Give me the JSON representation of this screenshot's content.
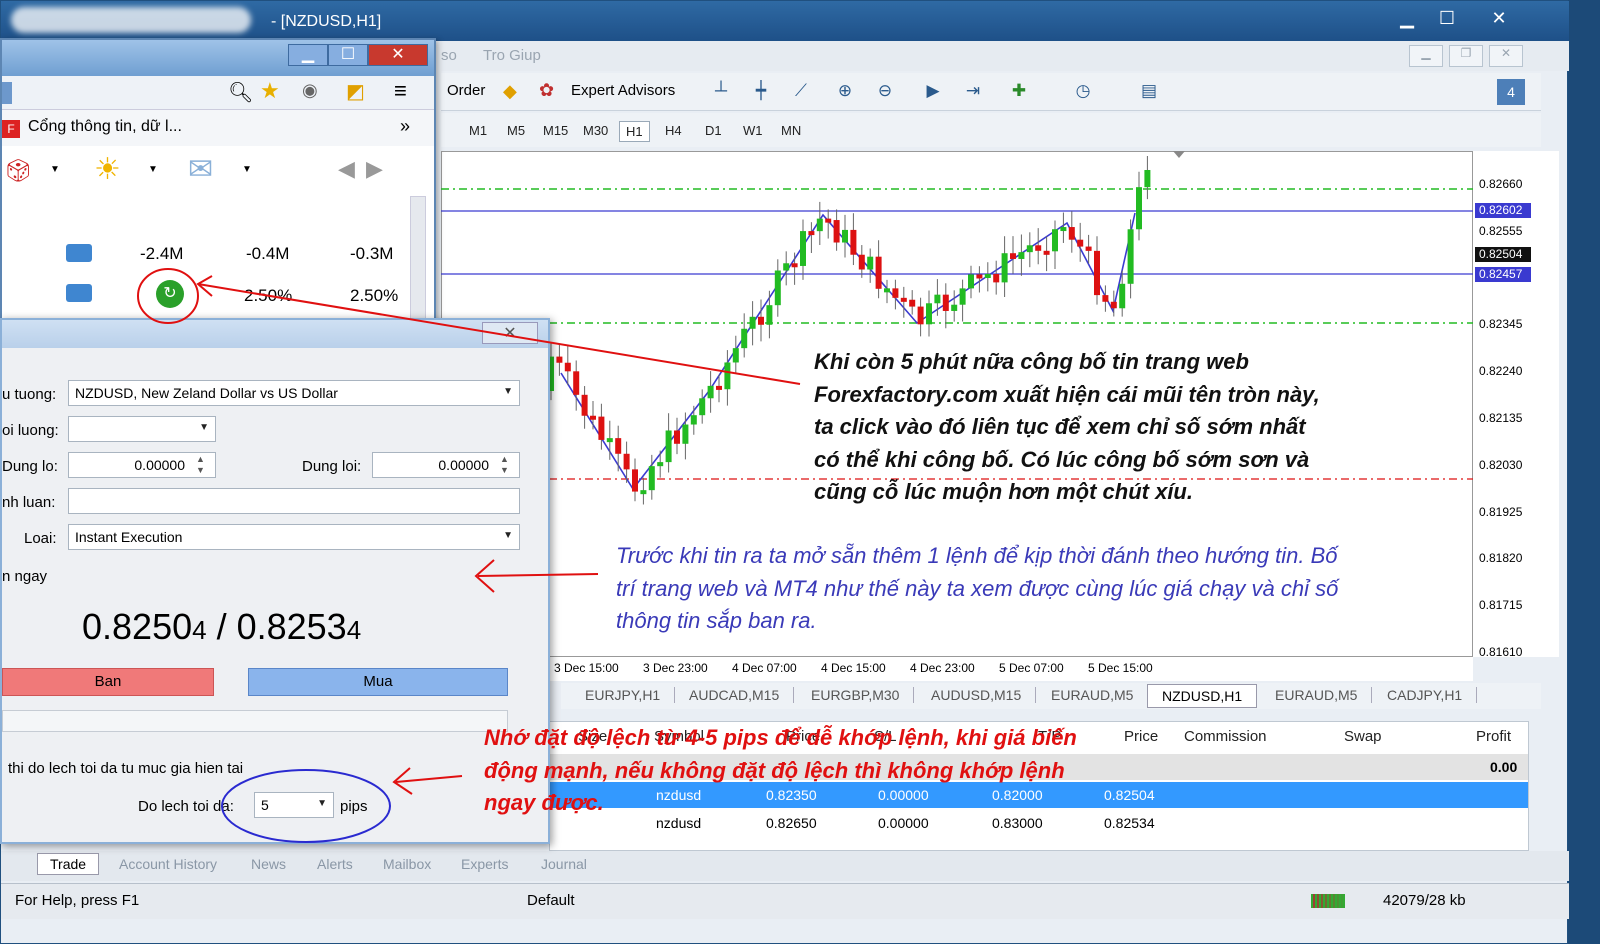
{
  "window": {
    "title": "- [NZDUSD,H1]",
    "min": "▁",
    "max": "☐",
    "close": "✕"
  },
  "menu": {
    "items": [
      "so",
      "Tro Giup"
    ]
  },
  "toolbar": {
    "order_label": "Order",
    "experts_label": "Expert Advisors"
  },
  "timeframes": [
    "M1",
    "M5",
    "M15",
    "M30",
    "H1",
    "H4",
    "D1",
    "W1",
    "MN"
  ],
  "active_timeframe": "H1",
  "chart": {
    "price_ticks": [
      "0.82660",
      "0.82555",
      "0.82450",
      "0.82345",
      "0.82240",
      "0.82135",
      "0.82030",
      "0.81925",
      "0.81820",
      "0.81715",
      "0.81610"
    ],
    "price_labels": [
      {
        "text": "0.82602",
        "color": "#3a3ad0"
      },
      {
        "text": "0.82504",
        "color": "#111111"
      },
      {
        "text": "0.82457",
        "color": "#3a3ad0"
      }
    ],
    "time_ticks": [
      "3 Dec 15:00",
      "3 Dec 23:00",
      "4 Dec 07:00",
      "4 Dec 15:00",
      "4 Dec 23:00",
      "5 Dec 07:00",
      "5 Dec 15:00"
    ],
    "bull_color": "#22bb22",
    "bear_color": "#dd1111"
  },
  "chart_tabs": [
    "EURJPY,H1",
    "AUDCAD,M15",
    "EURGBP,M30",
    "AUDUSD,M15",
    "EURAUD,M5",
    "NZDUSD,H1",
    "EURAUD,M5",
    "CADJPY,H1"
  ],
  "active_chart_tab": "NZDUSD,H1",
  "terminal": {
    "headers": [
      "Size",
      "Symbol",
      "Price",
      "S/L",
      "T/P",
      "Price",
      "Commission",
      "Swap",
      "Profit"
    ],
    "balance_profit": "0.00",
    "rows": [
      {
        "symbol": "nzdusd",
        "price": "0.82350",
        "sl": "0.00000",
        "tp": "0.82000",
        "cur": "0.82504",
        "selected": true
      },
      {
        "symbol": "nzdusd",
        "price": "0.82650",
        "sl": "0.00000",
        "tp": "0.83000",
        "cur": "0.82534",
        "selected": false
      }
    ]
  },
  "bottom_tabs": [
    "Trade",
    "Account History",
    "News",
    "Alerts",
    "Mailbox",
    "Experts",
    "Journal"
  ],
  "status": {
    "help": "For Help, press F1",
    "profile": "Default",
    "traffic": "42079/28 kb"
  },
  "browser": {
    "bookmark": "Cổng thông tin, dữ l...",
    "more": "»",
    "row1": [
      "-2.4M",
      "-0.4M",
      "-0.3M"
    ],
    "row2": [
      "2.50%",
      "2.50%"
    ]
  },
  "order": {
    "symbol_label": "u tuong:",
    "symbol_value": "NZDUSD, New Zeland Dollar vs US Dollar",
    "volume_label": "oi luong:",
    "sl_label": "Dung lo:",
    "sl_value": "0.00000",
    "tp_label": "Dung loi:",
    "tp_value": "0.00000",
    "comment_label": "nh luan:",
    "type_label": "Loai:",
    "type_value": "Instant Execution",
    "section_label": "n ngay",
    "bid": "0.8250",
    "bid_small": "4",
    "sep": " / ",
    "ask": "0.8253",
    "ask_small": "4",
    "sell_label": "Ban",
    "buy_label": "Mua",
    "deviation_note": "thi do lech toi da tu muc gia hien tai",
    "deviation_label": "Do lech toi da:",
    "deviation_value": "5",
    "deviation_unit": "pips"
  },
  "annotations": {
    "black": [
      "Khi còn 5 phút nữa công bố tin trang web",
      "Forexfactory.com xuất hiện cái mũi tên tròn này,",
      "ta click vào đó liên tục để xem chỉ số sớm nhất",
      "có thể khi công bố. Có lúc công bố sớm sơn và",
      "cũng cỗ lúc muộn hơn một chút xíu."
    ],
    "blue": [
      "Trước khi tin ra ta mở sẵn thêm 1 lệnh để kịp thời đánh theo hướng tin. Bố",
      "trí trang web và MT4 như thế này ta xem được cùng lúc giá chạy và chỉ số",
      "thông tin sắp ban ra."
    ],
    "red": [
      "Nhớ đặt độ lệch từ 4-5 pips để dễ khớp lệnh, khi giá biến",
      "động mạnh, nếu không đặt độ lệch thì không khớp lệnh",
      "ngay được."
    ]
  }
}
